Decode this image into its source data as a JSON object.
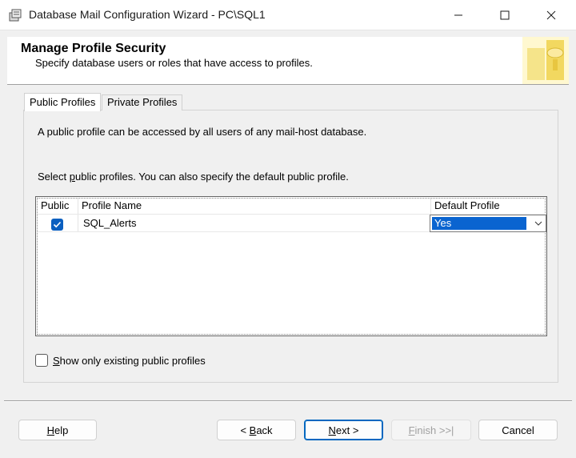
{
  "window": {
    "title": "Database Mail Configuration Wizard - PC\\SQL1",
    "icons": [
      "app-icon",
      "minimize-icon",
      "maximize-icon",
      "close-icon"
    ]
  },
  "header": {
    "title": "Manage Profile Security",
    "subtitle": "Specify database users or roles that have access to profiles."
  },
  "tabs": [
    {
      "label": "Public Profiles",
      "active": true
    },
    {
      "label": "Private Profiles",
      "active": false
    }
  ],
  "panel": {
    "description": "A public profile can be accessed by all users of any mail-host database.",
    "instruction_pre": "Select ",
    "instruction_ul": "p",
    "instruction_post": "ublic profiles. You can also specify the default public profile."
  },
  "grid": {
    "columns": [
      "Public",
      "Profile Name",
      "Default Profile"
    ],
    "rows": [
      {
        "public": true,
        "profile_name": "SQL_Alerts",
        "default_profile": "Yes"
      }
    ]
  },
  "show_only": {
    "checked": false,
    "ul": "S",
    "rest": "how only existing public profiles"
  },
  "buttons": {
    "help_ul": "H",
    "help_rest": "elp",
    "back_pre": "< ",
    "back_ul": "B",
    "back_rest": "ack",
    "next_ul": "N",
    "next_rest": "ext >",
    "finish_ul": "F",
    "finish_rest": "inish >>|",
    "cancel": "Cancel"
  },
  "colors": {
    "accent": "#0a64d0",
    "checkbox": "#0a5fc0"
  }
}
